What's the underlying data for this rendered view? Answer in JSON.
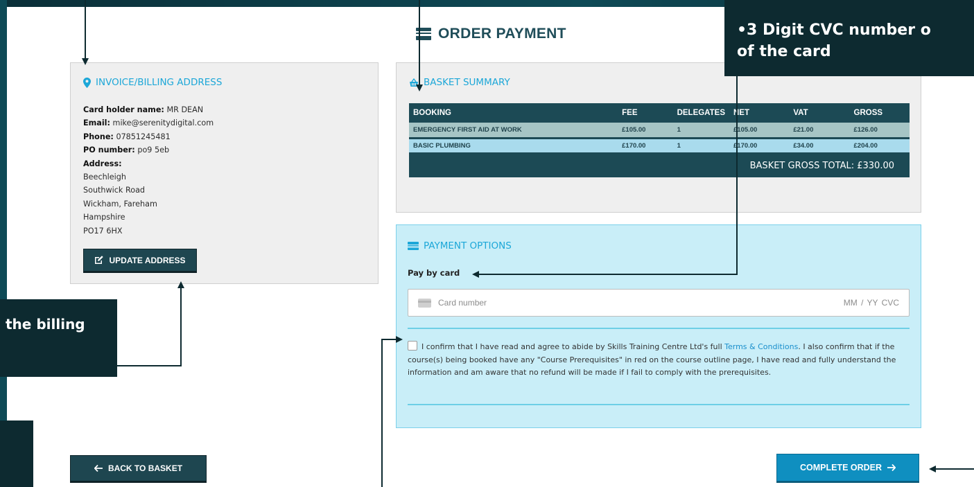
{
  "page": {
    "title": "ORDER PAYMENT"
  },
  "billing": {
    "heading": "INVOICE/BILLING ADDRESS",
    "lines": [
      {
        "label": "Card holder name:",
        "value": " MR DEAN"
      },
      {
        "label": "Email:",
        "value": " mike@serenitydigital.com"
      },
      {
        "label": "Phone:",
        "value": " 07851245481"
      },
      {
        "label": "PO number:",
        "value": " po9 5eb"
      },
      {
        "label": "Address:",
        "value": ""
      },
      {
        "label": "",
        "value": "Beechleigh"
      },
      {
        "label": "",
        "value": "Southwick Road"
      },
      {
        "label": "",
        "value": "Wickham, Fareham"
      },
      {
        "label": "",
        "value": "Hampshire"
      },
      {
        "label": "",
        "value": "PO17 6HX"
      }
    ],
    "update_button": "UPDATE ADDRESS"
  },
  "basket": {
    "heading": "BASKET SUMMARY",
    "columns": [
      "BOOKING",
      "FEE",
      "DELEGATES",
      "NET",
      "VAT",
      "GROSS"
    ],
    "rows": [
      [
        "EMERGENCY FIRST AID AT WORK",
        "£105.00",
        "1",
        "£105.00",
        "£21.00",
        "£126.00"
      ],
      [
        "BASIC PLUMBING",
        "£170.00",
        "1",
        "£170.00",
        "£34.00",
        "£204.00"
      ]
    ],
    "total": "BASKET GROSS TOTAL:  £330.00"
  },
  "payment": {
    "heading": "PAYMENT OPTIONS",
    "pay_label": "Pay by card",
    "card_placeholder": "Card number",
    "card_exp": "MM / YY  CVC",
    "terms_before": "I confirm that I have read and agree to abide by Skills Training Centre Ltd's full ",
    "terms_link": "Terms & Conditions",
    "terms_after": ". I also confirm that if the course(s) being booked have any \"Course Prerequisites\" in red on the course outline page, I have read and fully understand the information and am aware that no refund will be made if I fail to comply with the prerequisites."
  },
  "nav": {
    "back_button": "BACK TO BASKET",
    "complete_button": "COMPLETE ORDER"
  },
  "callouts": {
    "cvc_line1": "•3 Digit CVC number o",
    "cvc_line2": "of the card",
    "billing_text": "the billing"
  },
  "colors": {
    "accent": "#1ca7d8",
    "dark": "#1c4a55",
    "callout": "#0d2a30",
    "complete": "#0f8fc0"
  }
}
